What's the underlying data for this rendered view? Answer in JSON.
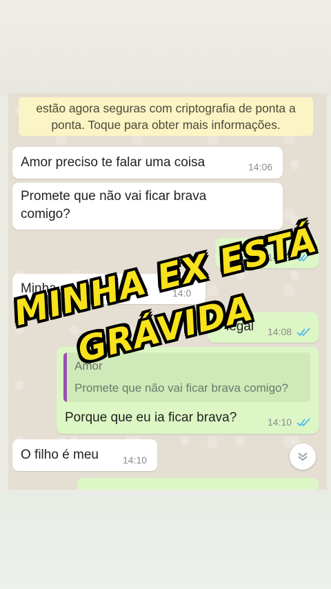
{
  "notice": {
    "line1": "estão agora seguras com criptografia de ponta a",
    "line2": "ponta. Toque para obter mais informações."
  },
  "messages": [
    {
      "direction": "in",
      "text": "Amor preciso te falar uma coisa",
      "time": "14:06"
    },
    {
      "direction": "in",
      "text_line1": "Promete que não vai ficar brava",
      "text_line2": "comigo?"
    },
    {
      "direction": "out",
      "text": "oi?",
      "time": "14:07",
      "status": "read"
    },
    {
      "direction": "in",
      "text": "Minha ex",
      "time": "14:0"
    },
    {
      "direction": "out",
      "text": "legal",
      "time": "14:08",
      "status": "read"
    },
    {
      "direction": "out",
      "quote_author": "Amor",
      "quote_text": "Promete que não vai ficar brava comigo?",
      "text": "Porque que eu ia ficar brava?",
      "time": "14:10",
      "status": "read"
    },
    {
      "direction": "in",
      "text": "O filho é meu",
      "time": "14:10"
    }
  ],
  "overlay": {
    "line1": "MINHA EX ESTÁ",
    "line2": "GRÁVIDA"
  },
  "colors": {
    "tick": "#4fb6ec",
    "overlay_text": "#f7e21b",
    "incoming": "#ffffff",
    "outgoing": "#dcf7c5"
  },
  "icons": [
    "read-receipt-icon",
    "chevron-down-icon"
  ]
}
